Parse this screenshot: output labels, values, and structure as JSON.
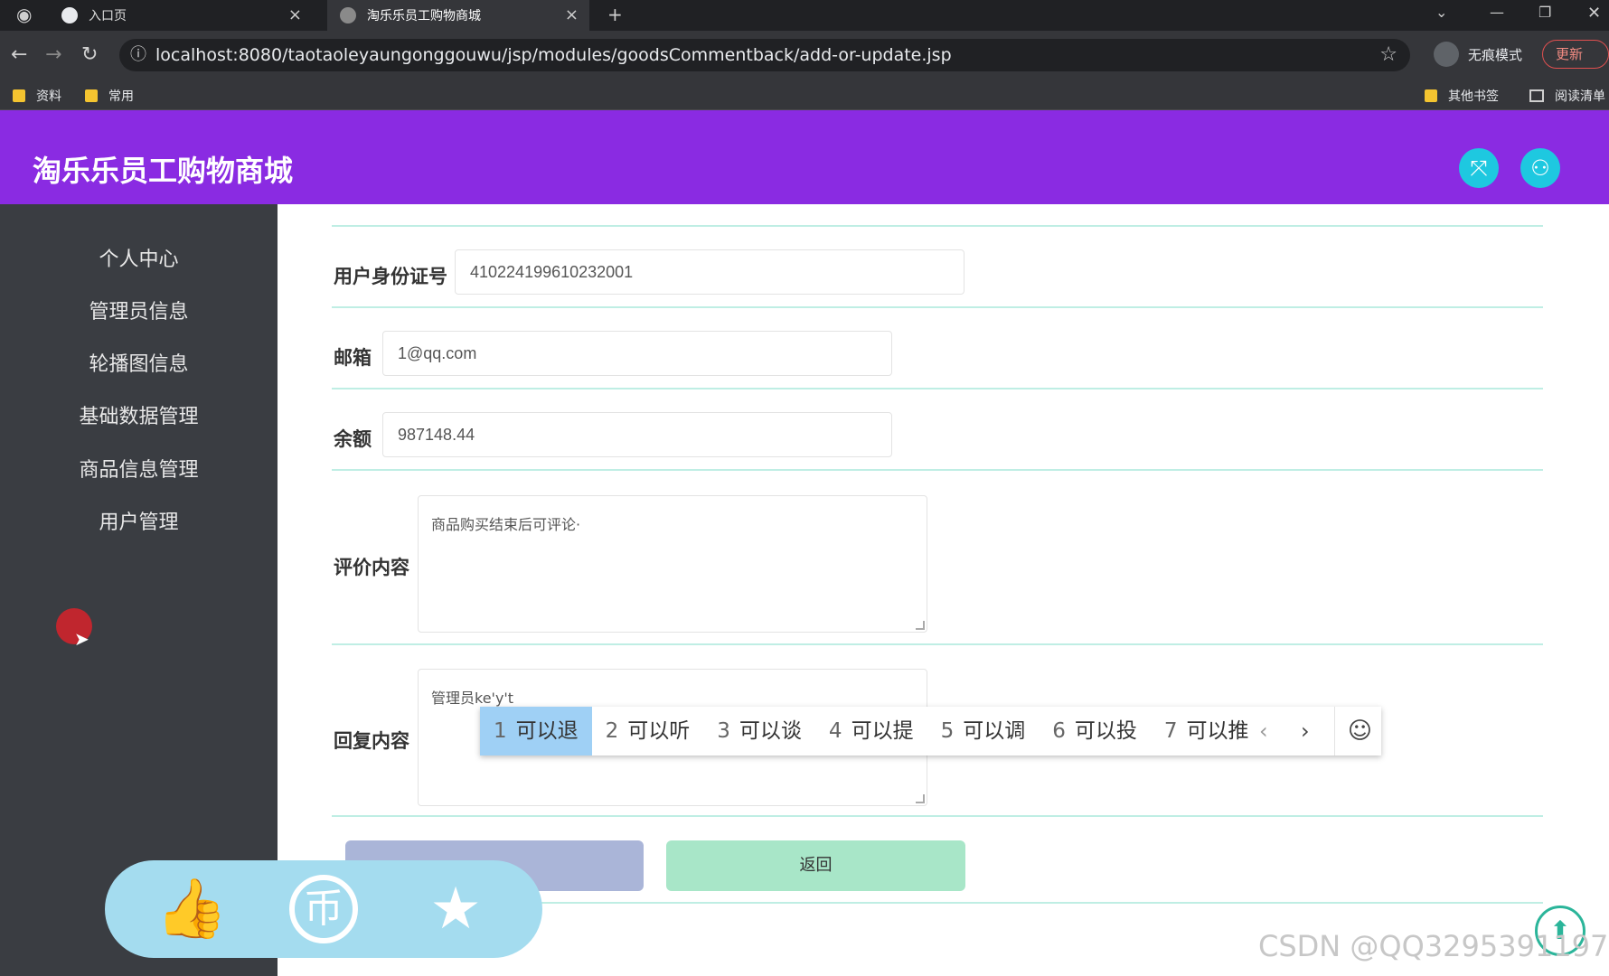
{
  "browser": {
    "tabs": [
      {
        "title": "入口页",
        "close": "×"
      },
      {
        "title": "淘乐乐员工购物商城",
        "close": "×"
      }
    ],
    "new_tab": "+",
    "url": "localhost:8080/taotaoleyaungonggouwu/jsp/modules/goodsCommentback/add-or-update.jsp",
    "incognito_label": "无痕模式",
    "update_label": "更新",
    "bookmarks": [
      "资料",
      "常用"
    ],
    "bookmarks_right": [
      "其他书签",
      "阅读清单"
    ]
  },
  "header": {
    "title": "淘乐乐员工购物商城"
  },
  "sidebar": {
    "items": [
      {
        "label": "个人中心"
      },
      {
        "label": "管理员信息"
      },
      {
        "label": "轮播图信息"
      },
      {
        "label": "基础数据管理"
      },
      {
        "label": "商品信息管理"
      },
      {
        "label": "用户管理"
      }
    ]
  },
  "form": {
    "id_card_label": "用户身份证号",
    "id_card_value": "410224199610232001",
    "email_label": "邮箱",
    "email_value": "1@qq.com",
    "balance_label": "余额",
    "balance_value": "987148.44",
    "comment_label": "评价内容",
    "comment_value": "商品购买结束后可评论·",
    "reply_label": "回复内容",
    "reply_value": "管理员ke'y't",
    "back_button": "返回"
  },
  "ime": {
    "candidates": [
      {
        "n": "1",
        "text": "可以退"
      },
      {
        "n": "2",
        "text": "可以听"
      },
      {
        "n": "3",
        "text": "可以谈"
      },
      {
        "n": "4",
        "text": "可以提"
      },
      {
        "n": "5",
        "text": "可以调"
      },
      {
        "n": "6",
        "text": "可以投"
      },
      {
        "n": "7",
        "text": "可以推"
      }
    ],
    "prev": "‹",
    "next": "›",
    "emoji": "☺"
  },
  "watermark": "CSDN @QQ3295391197",
  "colors": {
    "header": "#8a2be2",
    "sidebar": "#3a3d42",
    "accent": "#1ec8e0",
    "divider": "#bfeee4"
  }
}
